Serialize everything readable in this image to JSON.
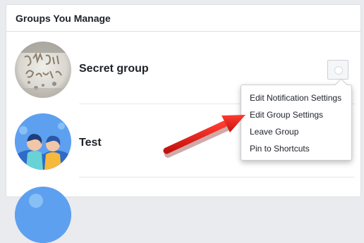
{
  "panel": {
    "title": "Groups You Manage"
  },
  "groups": [
    {
      "name": "Secret group",
      "avatar": "new-year-greeting-photo"
    },
    {
      "name": "Test",
      "avatar": "people-illustration"
    },
    {
      "name": "",
      "avatar": "people-illustration"
    }
  ],
  "menu": {
    "items": [
      "Edit Notification Settings",
      "Edit Group Settings",
      "Leave Group",
      "Pin to Shortcuts"
    ]
  },
  "annotation": {
    "arrow_color": "#e0201c",
    "points_to": "Edit Group Settings"
  }
}
